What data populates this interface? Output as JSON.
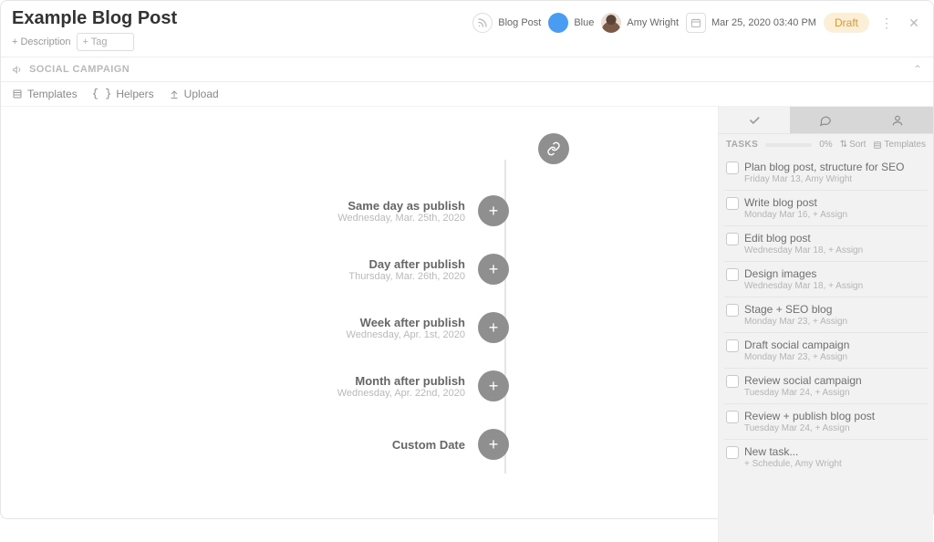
{
  "header": {
    "title": "Example Blog Post",
    "add_description": "+ Description",
    "tag_placeholder": "+ Tag",
    "content_type": "Blog Post",
    "color_name": "Blue",
    "owner_name": "Amy Wright",
    "datetime": "Mar 25, 2020 03:40 PM",
    "status": "Draft"
  },
  "section": {
    "name": "SOCIAL CAMPAIGN"
  },
  "toolbar": {
    "templates": "Templates",
    "helpers": "Helpers",
    "upload": "Upload"
  },
  "timeline_nodes": [
    {
      "title": "Same day as publish",
      "date": "Wednesday, Mar. 25th, 2020"
    },
    {
      "title": "Day after publish",
      "date": "Thursday, Mar. 26th, 2020"
    },
    {
      "title": "Week after publish",
      "date": "Wednesday, Apr. 1st, 2020"
    },
    {
      "title": "Month after publish",
      "date": "Wednesday, Apr. 22nd, 2020"
    },
    {
      "title": "Custom Date",
      "date": ""
    }
  ],
  "sidebar": {
    "tasks_label": "TASKS",
    "progress_pct": "0%",
    "sort_label": "Sort",
    "templates_label": "Templates",
    "tasks": [
      {
        "name": "Plan blog post, structure for SEO",
        "meta": "Friday Mar 13,   Amy Wright"
      },
      {
        "name": "Write blog post",
        "meta": "Monday Mar 16,   + Assign"
      },
      {
        "name": "Edit blog post",
        "meta": "Wednesday Mar 18,   + Assign"
      },
      {
        "name": "Design images",
        "meta": "Wednesday Mar 18,   + Assign"
      },
      {
        "name": "Stage + SEO blog",
        "meta": "Monday Mar 23,   + Assign"
      },
      {
        "name": "Draft social campaign",
        "meta": "Monday Mar 23,   + Assign"
      },
      {
        "name": "Review social campaign",
        "meta": "Tuesday Mar 24,   + Assign"
      },
      {
        "name": "Review + publish blog post",
        "meta": "Tuesday Mar 24,   + Assign"
      }
    ],
    "new_task": {
      "name": "New task...",
      "meta": "+ Schedule,   Amy Wright"
    }
  }
}
